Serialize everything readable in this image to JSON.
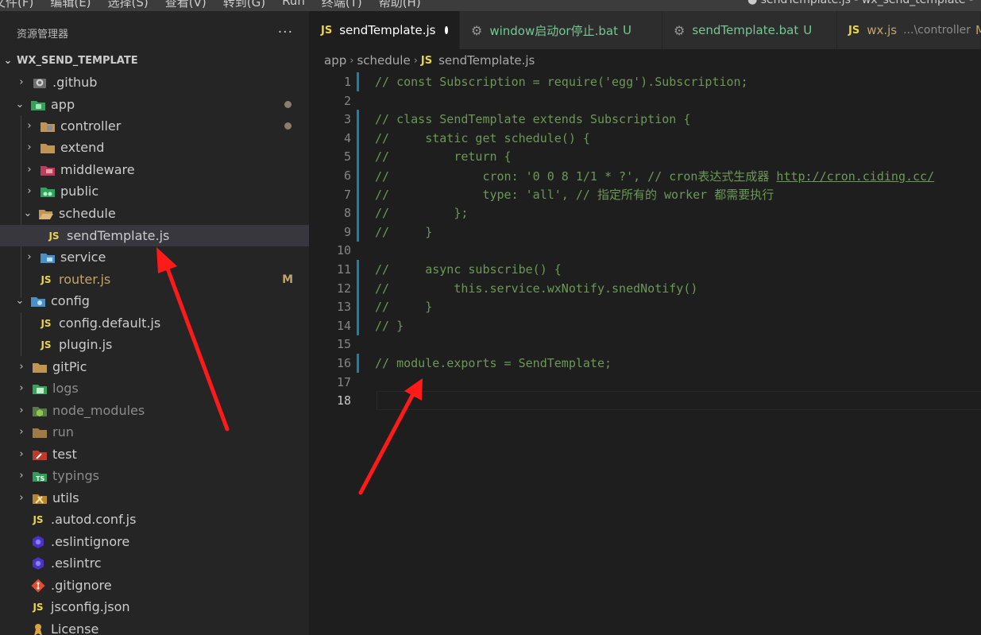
{
  "menubar": {
    "items": [
      "文件(F)",
      "编辑(E)",
      "选择(S)",
      "查看(V)",
      "转到(G)",
      "Run",
      "终端(T)",
      "帮助(H)"
    ],
    "window_title": "● sendTemplate.js - wx_send_template -"
  },
  "sidebar": {
    "title": "资源管理器",
    "more": "···",
    "root": "WX_SEND_TEMPLATE",
    "items": [
      {
        "label": ".github",
        "icon": "github-folder-icon"
      },
      {
        "label": "app",
        "icon": "app-folder-icon"
      },
      {
        "label": "controller",
        "icon": "controller-folder-icon"
      },
      {
        "label": "extend",
        "icon": "folder-icon"
      },
      {
        "label": "middleware",
        "icon": "middleware-folder-icon"
      },
      {
        "label": "public",
        "icon": "public-folder-icon"
      },
      {
        "label": "schedule",
        "icon": "folder-open-icon"
      },
      {
        "label": "sendTemplate.js",
        "icon": "js-file-icon"
      },
      {
        "label": "service",
        "icon": "service-folder-icon"
      },
      {
        "label": "router.js",
        "icon": "js-file-icon",
        "badge": "M"
      },
      {
        "label": "config",
        "icon": "config-folder-icon"
      },
      {
        "label": "config.default.js",
        "icon": "js-file-icon"
      },
      {
        "label": "plugin.js",
        "icon": "js-file-icon"
      },
      {
        "label": "gitPic",
        "icon": "folder-icon"
      },
      {
        "label": "logs",
        "icon": "logs-folder-icon"
      },
      {
        "label": "node_modules",
        "icon": "node-folder-icon"
      },
      {
        "label": "run",
        "icon": "folder-icon"
      },
      {
        "label": "test",
        "icon": "test-folder-icon"
      },
      {
        "label": "typings",
        "icon": "ts-folder-icon"
      },
      {
        "label": "utils",
        "icon": "utils-folder-icon"
      },
      {
        "label": ".autod.conf.js",
        "icon": "js-file-icon"
      },
      {
        "label": ".eslintignore",
        "icon": "eslint-icon"
      },
      {
        "label": ".eslintrc",
        "icon": "eslint-icon"
      },
      {
        "label": ".gitignore",
        "icon": "git-icon"
      },
      {
        "label": "jsconfig.json",
        "icon": "jsconfig-icon"
      },
      {
        "label": "License",
        "icon": "license-icon"
      }
    ]
  },
  "tabs": [
    {
      "label": "sendTemplate.js",
      "icon": "js-file-icon",
      "active": true,
      "dirty": true
    },
    {
      "label": "window启动or停止.bat",
      "icon": "gear-icon",
      "status": "U"
    },
    {
      "label": "sendTemplate.bat",
      "icon": "gear-icon",
      "status": "U"
    },
    {
      "label": "wx.js",
      "icon": "js-file-icon",
      "path": "...\\controller",
      "status": "M"
    }
  ],
  "breadcrumb": [
    "app",
    "schedule",
    "sendTemplate.js"
  ],
  "code": {
    "lines": [
      {
        "n": "1",
        "text": "// const Subscription = require('egg').Subscription;"
      },
      {
        "n": "2",
        "text": ""
      },
      {
        "n": "3",
        "text": "// class SendTemplate extends Subscription {"
      },
      {
        "n": "4",
        "text": "//     static get schedule() {"
      },
      {
        "n": "5",
        "text": "//         return {"
      },
      {
        "n": "6",
        "text": "//             cron: '0 0 8 1/1 * ?', // cron表达式生成器 ",
        "link": "http://cron.ciding.cc/"
      },
      {
        "n": "7",
        "text": "//             type: 'all', // 指定所有的 worker 都需要执行"
      },
      {
        "n": "8",
        "text": "//         };"
      },
      {
        "n": "9",
        "text": "//     }"
      },
      {
        "n": "10",
        "text": ""
      },
      {
        "n": "11",
        "text": "//     async subscribe() {"
      },
      {
        "n": "12",
        "text": "//         this.service.wxNotify.snedNotify()"
      },
      {
        "n": "13",
        "text": "//     }"
      },
      {
        "n": "14",
        "text": "// }"
      },
      {
        "n": "15",
        "text": ""
      },
      {
        "n": "16",
        "text": "// module.exports = SendTemplate;"
      },
      {
        "n": "17",
        "text": ""
      },
      {
        "n": "18",
        "text": ""
      }
    ]
  },
  "colors": {
    "accent": "#1b81a8",
    "comment": "#6a9955",
    "modified": "#c2a36b",
    "untracked": "#73c991",
    "arrow": "#ff1a1a"
  }
}
